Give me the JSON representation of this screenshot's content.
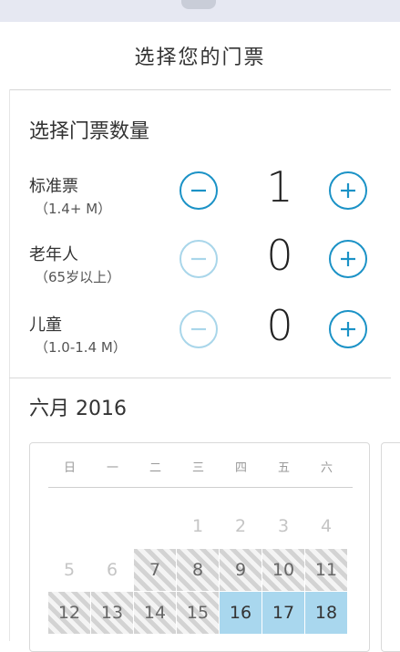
{
  "header": {
    "title": "选择您的门票"
  },
  "tickets": {
    "section_title": "选择门票数量",
    "rows": [
      {
        "name": "标准票",
        "sub": "（1.4+ M）",
        "count": "1",
        "minus_enabled": true
      },
      {
        "name": "老年人",
        "sub": "（65岁以上）",
        "count": "0",
        "minus_enabled": false
      },
      {
        "name": "儿童",
        "sub": "（1.0-1.4 M）",
        "count": "0",
        "minus_enabled": false
      }
    ]
  },
  "calendar": {
    "month_title": "六月 2016",
    "weekdays": [
      "日",
      "一",
      "二",
      "三",
      "四",
      "五",
      "六"
    ],
    "weeks": [
      [
        "",
        "",
        "",
        "1",
        "2",
        "3",
        "4"
      ],
      [
        "5",
        "6",
        "7",
        "8",
        "9",
        "10",
        "11"
      ],
      [
        "12",
        "13",
        "14",
        "15",
        "16",
        "17",
        "18"
      ]
    ],
    "striped_days": [
      "7",
      "8",
      "9",
      "10",
      "11",
      "12",
      "13",
      "14",
      "15"
    ],
    "selected_days": [
      "16",
      "17",
      "18"
    ]
  },
  "colors": {
    "accent": "#1b92c6",
    "accent_disabled": "#a9d6ea",
    "selected_day": "#a9d7ee"
  },
  "icons": {
    "minus": "minus-circle-icon",
    "plus": "plus-circle-icon"
  }
}
